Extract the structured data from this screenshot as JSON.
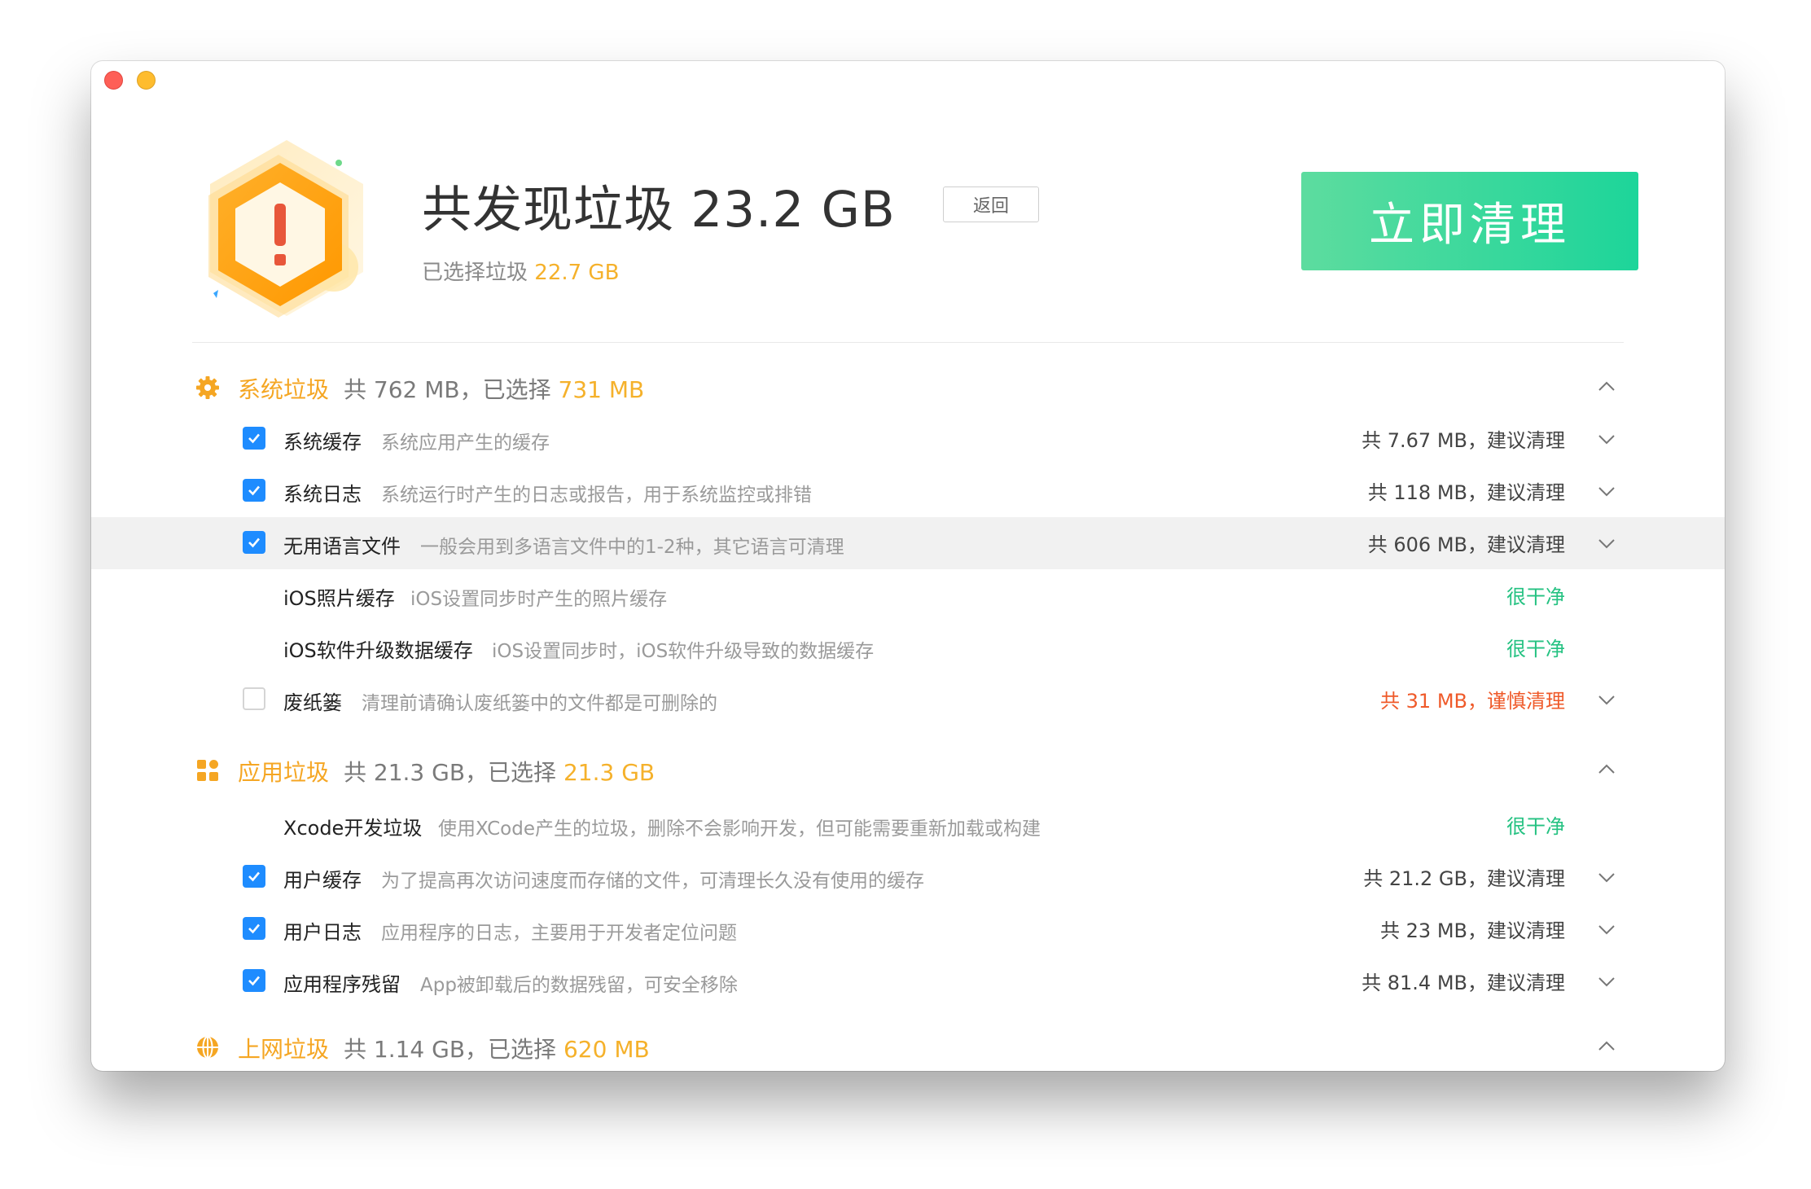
{
  "header": {
    "title": "共发现垃圾 23.2 GB",
    "subtitle_prefix": "已选择垃圾",
    "subtitle_value": "22.7 GB",
    "back_label": "返回",
    "clean_label": "立即清理"
  },
  "categories": [
    {
      "name": "系统垃圾",
      "stats_prefix": "共 762 MB，已选择",
      "stats_selected": "731 MB",
      "icon": "gear-icon",
      "items": [
        {
          "name": "系统缓存",
          "desc": "系统应用产生的缓存",
          "size": "共 7.67 MB，建议清理",
          "checked": true
        },
        {
          "name": "系统日志",
          "desc": "系统运行时产生的日志或报告，用于系统监控或排错",
          "size": "共 118 MB，建议清理",
          "checked": true
        },
        {
          "name": "无用语言文件",
          "desc": "一般会用到多语言文件中的1-2种，其它语言可清理",
          "size": "共 606 MB，建议清理",
          "checked": true
        },
        {
          "name": "iOS照片缓存",
          "desc": "iOS设置同步时产生的照片缓存",
          "size": "很干净"
        },
        {
          "name": "iOS软件升级数据缓存",
          "desc": "iOS设置同步时，iOS软件升级导致的数据缓存",
          "size": "很干净"
        },
        {
          "name": "废纸篓",
          "desc": "清理前请确认废纸篓中的文件都是可删除的",
          "size": "共 31 MB，谨慎清理",
          "checked": false
        }
      ]
    },
    {
      "name": "应用垃圾",
      "stats_prefix": "共 21.3 GB，已选择",
      "stats_selected": "21.3 GB",
      "icon": "apps-grid-icon",
      "items": [
        {
          "name": "Xcode开发垃圾",
          "desc": "使用XCode产生的垃圾，删除不会影响开发，但可能需要重新加载或构建",
          "size": "很干净"
        },
        {
          "name": "用户缓存",
          "desc": "为了提高再次访问速度而存储的文件，可清理长久没有使用的缓存",
          "size": "共 21.2 GB，建议清理",
          "checked": true
        },
        {
          "name": "用户日志",
          "desc": "应用程序的日志，主要用于开发者定位问题",
          "size": "共 23 MB，建议清理",
          "checked": true
        },
        {
          "name": "应用程序残留",
          "desc": "App被卸载后的数据残留，可安全移除",
          "size": "共 81.4 MB，建议清理",
          "checked": true
        }
      ]
    },
    {
      "name": "上网垃圾",
      "stats_prefix": "共 1.14 GB，已选择",
      "stats_selected": "620 MB",
      "icon": "globe-icon"
    }
  ],
  "colors": {
    "accent_orange": "#f5a623",
    "selected_yellow": "#f5b12b",
    "checkbox_blue": "#1e8cff",
    "clean_green": "#25c282",
    "warn_red": "#ef5a2a",
    "button_green": "#1dd59a"
  }
}
